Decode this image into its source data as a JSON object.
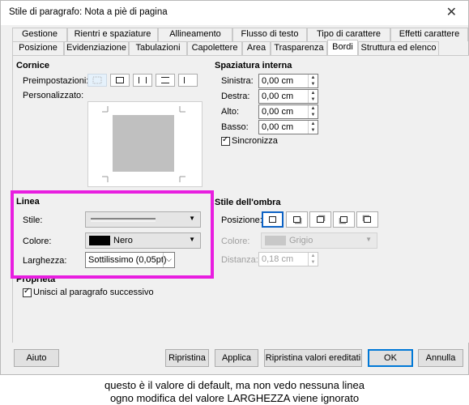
{
  "window": {
    "title": "Stile di paragrafo: Nota a piè di pagina",
    "close_glyph": "✕"
  },
  "tabs_row1": [
    "Gestione",
    "Rientri e spaziature",
    "Allineamento",
    "Flusso di testo",
    "Tipo di carattere",
    "Effetti carattere"
  ],
  "tabs_row2": [
    "Posizione",
    "Evidenziazione",
    "Tabulazioni",
    "Capolettere",
    "Area",
    "Trasparenza",
    "Bordi",
    "Struttura ed elenco"
  ],
  "active_tab": "Bordi",
  "cornice": {
    "heading": "Cornice",
    "preset_label": "Preimpostazioni:",
    "custom_label": "Personalizzato:"
  },
  "spaziatura": {
    "heading": "Spaziatura interna",
    "sinistra_label": "Sinistra:",
    "sinistra_value": "0,00 cm",
    "destra_label": "Destra:",
    "destra_value": "0,00 cm",
    "alto_label": "Alto:",
    "alto_value": "0,00 cm",
    "basso_label": "Basso:",
    "basso_value": "0,00 cm",
    "sincronizza_label": "Sincronizza",
    "sincronizza_checked": true,
    "check_glyph": "✓"
  },
  "linea": {
    "heading": "Linea",
    "stile_label": "Stile:",
    "colore_label": "Colore:",
    "colore_value": "Nero",
    "colore_swatch": "#000000",
    "larghezza_label": "Larghezza:",
    "larghezza_value": "Sottilissimo (0,05pt)",
    "caret_glyph": "▼",
    "small_caret_glyph": "⌵"
  },
  "ombra": {
    "heading": "Stile dell'ombra",
    "posizione_label": "Posizione:",
    "colore_label": "Colore:",
    "colore_value": "Grigio",
    "colore_swatch": "#c0c0c0",
    "distanza_label": "Distanza:",
    "distanza_value": "0,18 cm"
  },
  "proprieta": {
    "heading": "Proprietà",
    "unisci_label": "Unisci al paragrafo successivo",
    "unisci_checked": true
  },
  "buttons": {
    "aiuto": "Aiuto",
    "ripristina": "Ripristina",
    "applica": "Applica",
    "ripristina_ereditati": "Ripristina valori ereditati",
    "ok": "OK",
    "annulla": "Annulla"
  },
  "caption": {
    "line1": "questo è il valore di default, ma non vedo nessuna linea",
    "line2": "ogno modifica del valore LARGHEZZA viene ignorato"
  },
  "colors": {
    "highlight": "#e81ee0",
    "accent": "#0078d7"
  }
}
